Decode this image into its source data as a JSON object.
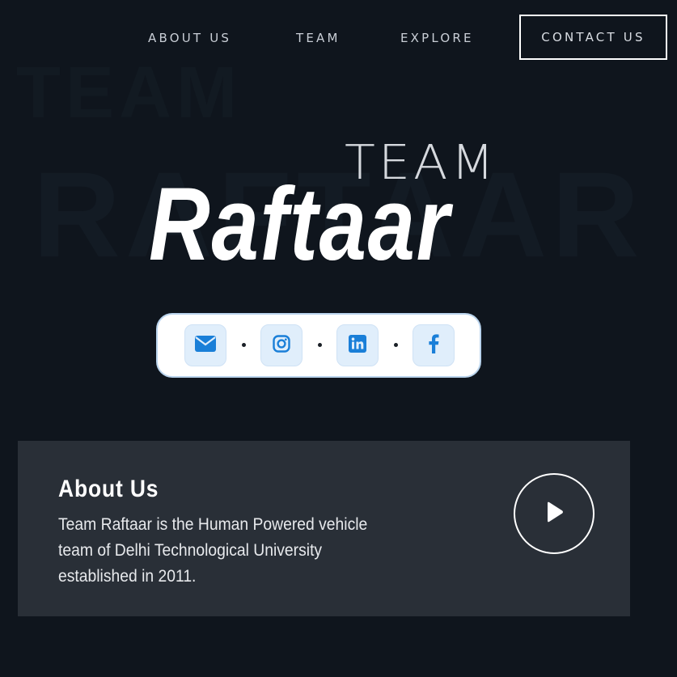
{
  "nav": {
    "items": [
      {
        "label": "ABOUT US"
      },
      {
        "label": "TEAM"
      },
      {
        "label": "EXPLORE"
      }
    ],
    "contact_label": "CONTACT US"
  },
  "hero": {
    "background_text": "RAFTAAR",
    "background_text_top": "TEAM",
    "team_label": "TEAM",
    "title": "Raftaar"
  },
  "social": {
    "icons": [
      "envelope-icon",
      "instagram-icon",
      "linkedin-icon",
      "facebook-icon"
    ],
    "icon_color": "#1a7fd8",
    "button_bg": "#e0eefb"
  },
  "about": {
    "title": "About Us",
    "text": "Team Raftaar is the Human Powered vehicle team of Delhi Technological University established in 2011.",
    "play_icon": "play-icon"
  },
  "colors": {
    "background": "#0f151d",
    "card": "#292f37",
    "accent": "#1a7fd8"
  }
}
